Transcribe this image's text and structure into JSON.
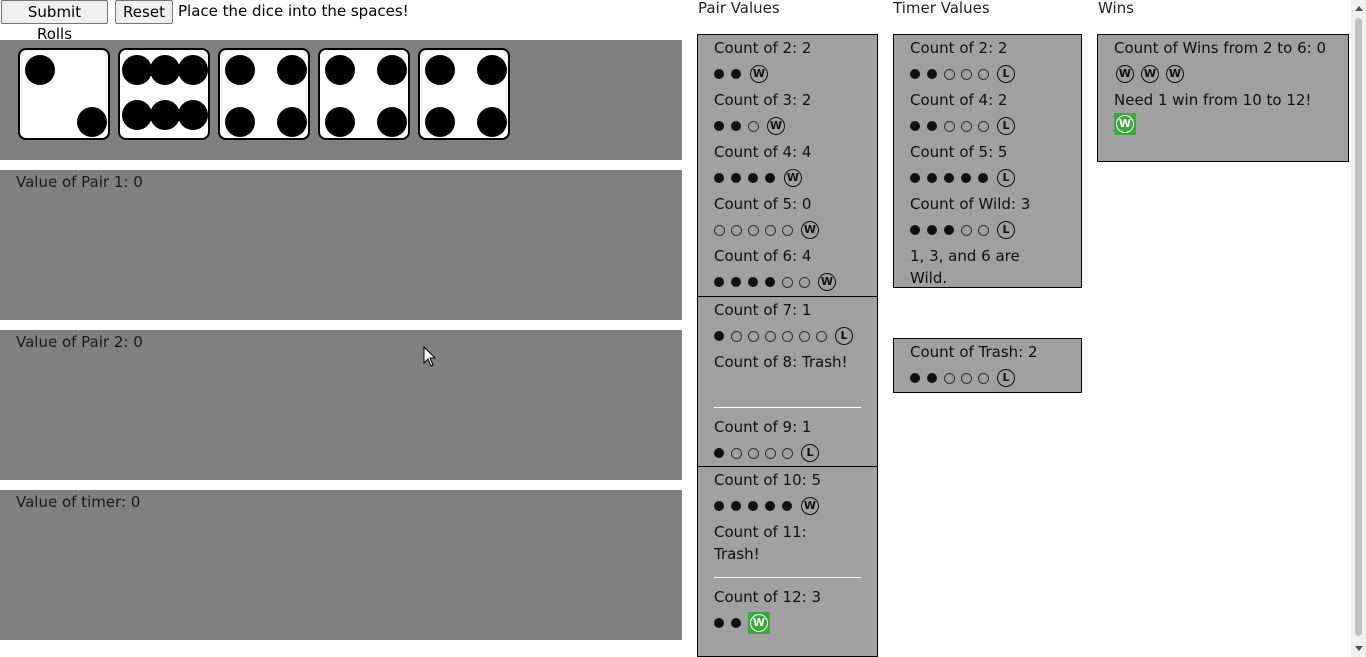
{
  "controls": {
    "submit_label": "Submit Rolls",
    "reset_label": "Reset",
    "instruction": "Place the dice into the spaces!"
  },
  "dice": [
    {
      "value": 2
    },
    {
      "value": 6
    },
    {
      "value": 4
    },
    {
      "value": 4
    },
    {
      "value": 4
    }
  ],
  "slots": {
    "pair1_label": "Value of Pair 1: 0",
    "pair2_label": "Value of Pair 2: 0",
    "timer_label": "Value of timer: 0"
  },
  "columns": {
    "pair_title": "Pair Values",
    "timer_title": "Timer Values",
    "wins_title": "Wins"
  },
  "pair_groups": [
    [
      {
        "label": "Count of 2: 2",
        "filled": 2,
        "empty": 0,
        "goal": "W",
        "won": false
      },
      {
        "label": "Count of 3: 2",
        "filled": 2,
        "empty": 1,
        "goal": "W",
        "won": false
      },
      {
        "label": "Count of 4: 4",
        "filled": 4,
        "empty": 0,
        "goal": "W",
        "won": false
      },
      {
        "label": "Count of 5: 0",
        "filled": 0,
        "empty": 5,
        "goal": "W",
        "won": false
      },
      {
        "label": "Count of 6: 4",
        "filled": 4,
        "empty": 2,
        "goal": "W",
        "won": false
      }
    ],
    [
      {
        "label": "Count of 7: 1",
        "filled": 1,
        "empty": 6,
        "goal": "L",
        "won": false
      },
      {
        "label": "Count of 8: Trash!",
        "trash": true
      },
      {
        "label": "Count of 9: 1",
        "filled": 1,
        "empty": 4,
        "goal": "L",
        "won": false
      }
    ],
    [
      {
        "label": "Count of 10: 5",
        "filled": 5,
        "empty": 0,
        "goal": "W",
        "won": false
      },
      {
        "label": "Count of 11: Trash!",
        "trash": true,
        "wrap": true
      },
      {
        "label": "Count of 12: 3",
        "filled": 2,
        "empty": 0,
        "goal": "W",
        "won": true
      }
    ]
  ],
  "timer_rows": [
    {
      "label": "Count of 2: 2",
      "filled": 2,
      "empty": 3,
      "goal": "L"
    },
    {
      "label": "Count of 4: 2",
      "filled": 2,
      "empty": 3,
      "goal": "L"
    },
    {
      "label": "Count of 5: 5",
      "filled": 5,
      "empty": 0,
      "goal": "L"
    },
    {
      "label": "Count of Wild: 3",
      "filled": 3,
      "empty": 2,
      "goal": "L"
    }
  ],
  "timer_note": "1, 3, and 6 are Wild.",
  "trash": {
    "label": "Count of Trash: 2",
    "filled": 2,
    "empty": 3,
    "goal": "L"
  },
  "wins": {
    "label": "Count of Wins from 2 to 6: 0",
    "badges": 3,
    "need_text": "Need 1 win from 10 to 12!",
    "need_badge_won": true
  },
  "icons": {
    "win": "W",
    "lose": "L"
  },
  "colors": {
    "won_green": "#3aa83a",
    "panel_gray": "#808080",
    "box_gray": "#a0a0a0"
  }
}
